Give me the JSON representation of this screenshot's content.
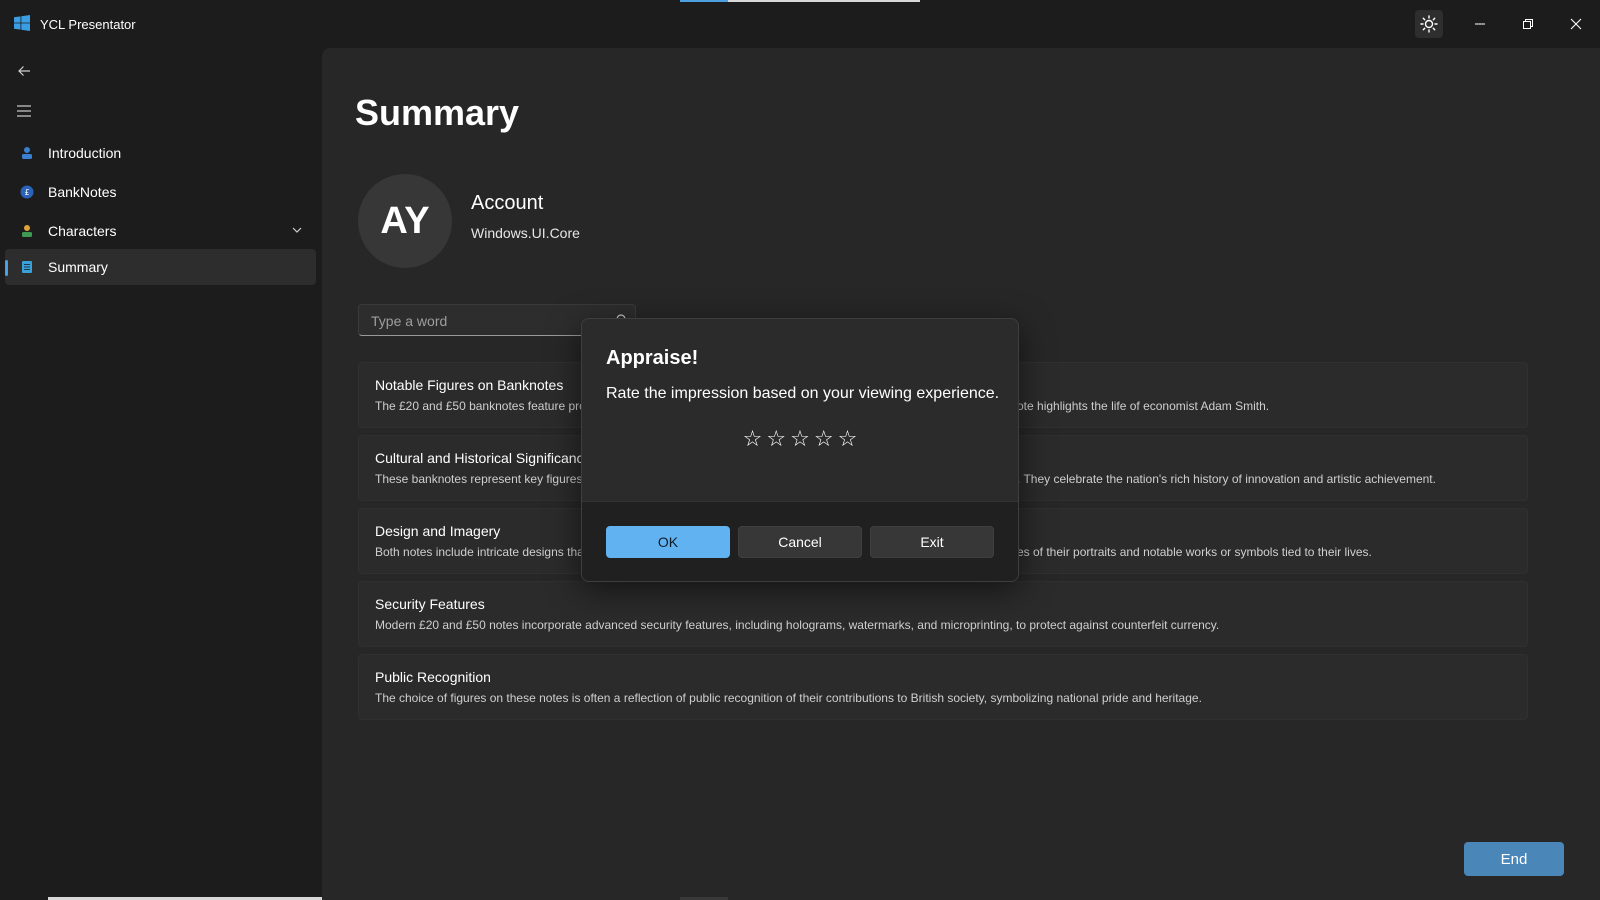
{
  "app": {
    "title": "YCL Presentator",
    "colors": {
      "accent": "#4ca0e0",
      "background": "#1c1c1c",
      "content_bg": "#272727",
      "ok_button": "#60b2f0",
      "end_button": "#4a86b8"
    }
  },
  "titlebar": {
    "icons": [
      "windows-logo-icon",
      "theme-toggle-icon",
      "minimize-icon",
      "restore-icon",
      "close-icon"
    ]
  },
  "sidebar": {
    "items": [
      {
        "label": "Introduction",
        "icon": "person-icon",
        "selected": false
      },
      {
        "label": "BankNotes",
        "icon": "pound-coin-icon",
        "selected": false
      },
      {
        "label": "Characters",
        "icon": "character-icon",
        "selected": false,
        "expandable": true
      },
      {
        "label": "Summary",
        "icon": "document-icon",
        "selected": true
      }
    ]
  },
  "main": {
    "title": "Summary",
    "account": {
      "initials": "AY",
      "title": "Account",
      "subtitle": "Windows.UI.Core"
    },
    "search": {
      "placeholder": "Type a word",
      "value": ""
    },
    "cards": [
      {
        "title": "Notable Figures on Banknotes",
        "desc_left": "The £20 and £50 banknotes feature pro",
        "desc_right": "ote highlights the life of economist Adam Smith."
      },
      {
        "title": "Cultural and Historical Significanc",
        "desc_left": "These banknotes represent key figures i",
        "desc_right": ". They celebrate the nation's rich history of innovation and artistic achievement."
      },
      {
        "title": "Design and Imagery",
        "desc_left": "Both notes include intricate designs tha",
        "desc_right": "es of their portraits and notable works or symbols tied to their lives."
      },
      {
        "title": "Security Features",
        "desc_left": "Modern £20 and £50 notes incorporate advanced security features, including holograms, watermarks, and microprinting, to protect against counterfeit currency.",
        "desc_right": ""
      },
      {
        "title": "Public Recognition",
        "desc_left": "The choice of figures on these notes is often a reflection of public recognition of their contributions to British society, symbolizing national pride and heritage.",
        "desc_right": ""
      }
    ],
    "end_button": "End"
  },
  "dialog": {
    "title": "Appraise!",
    "message": "Rate the impression based on your viewing experience.",
    "rating": {
      "value": 0,
      "max": 5,
      "star_glyph": "☆"
    },
    "buttons": {
      "ok": "OK",
      "cancel": "Cancel",
      "exit": "Exit"
    }
  }
}
